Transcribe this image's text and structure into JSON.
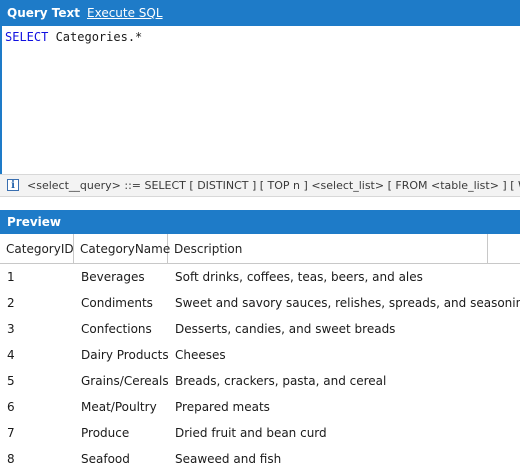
{
  "tabs": {
    "query_text": "Query Text",
    "execute_sql": "Execute SQL"
  },
  "editor": {
    "keyword": "SELECT",
    "rest": " Categories.*"
  },
  "hint": {
    "icon": "info-icon",
    "text": "<select__query> ::= SELECT [ DISTINCT ] [ TOP n ] <select_list> [ FROM <table_list> ] [ WHERE <search_condition> ]"
  },
  "preview": {
    "title": "Preview",
    "columns": [
      "CategoryID",
      "CategoryName",
      "Description"
    ],
    "rows": [
      [
        "1",
        "Beverages",
        "Soft drinks, coffees, teas, beers, and ales"
      ],
      [
        "2",
        "Condiments",
        "Sweet and savory sauces, relishes, spreads, and seasonings"
      ],
      [
        "3",
        "Confections",
        "Desserts, candies, and sweet breads"
      ],
      [
        "4",
        "Dairy Products",
        "Cheeses"
      ],
      [
        "5",
        "Grains/Cereals",
        "Breads, crackers, pasta, and cereal"
      ],
      [
        "6",
        "Meat/Poultry",
        "Prepared meats"
      ],
      [
        "7",
        "Produce",
        "Dried fruit and bean curd"
      ],
      [
        "8",
        "Seafood",
        "Seaweed and fish"
      ]
    ]
  },
  "colors": {
    "accent": "#1e7bc8",
    "keyword": "#1010e0"
  }
}
